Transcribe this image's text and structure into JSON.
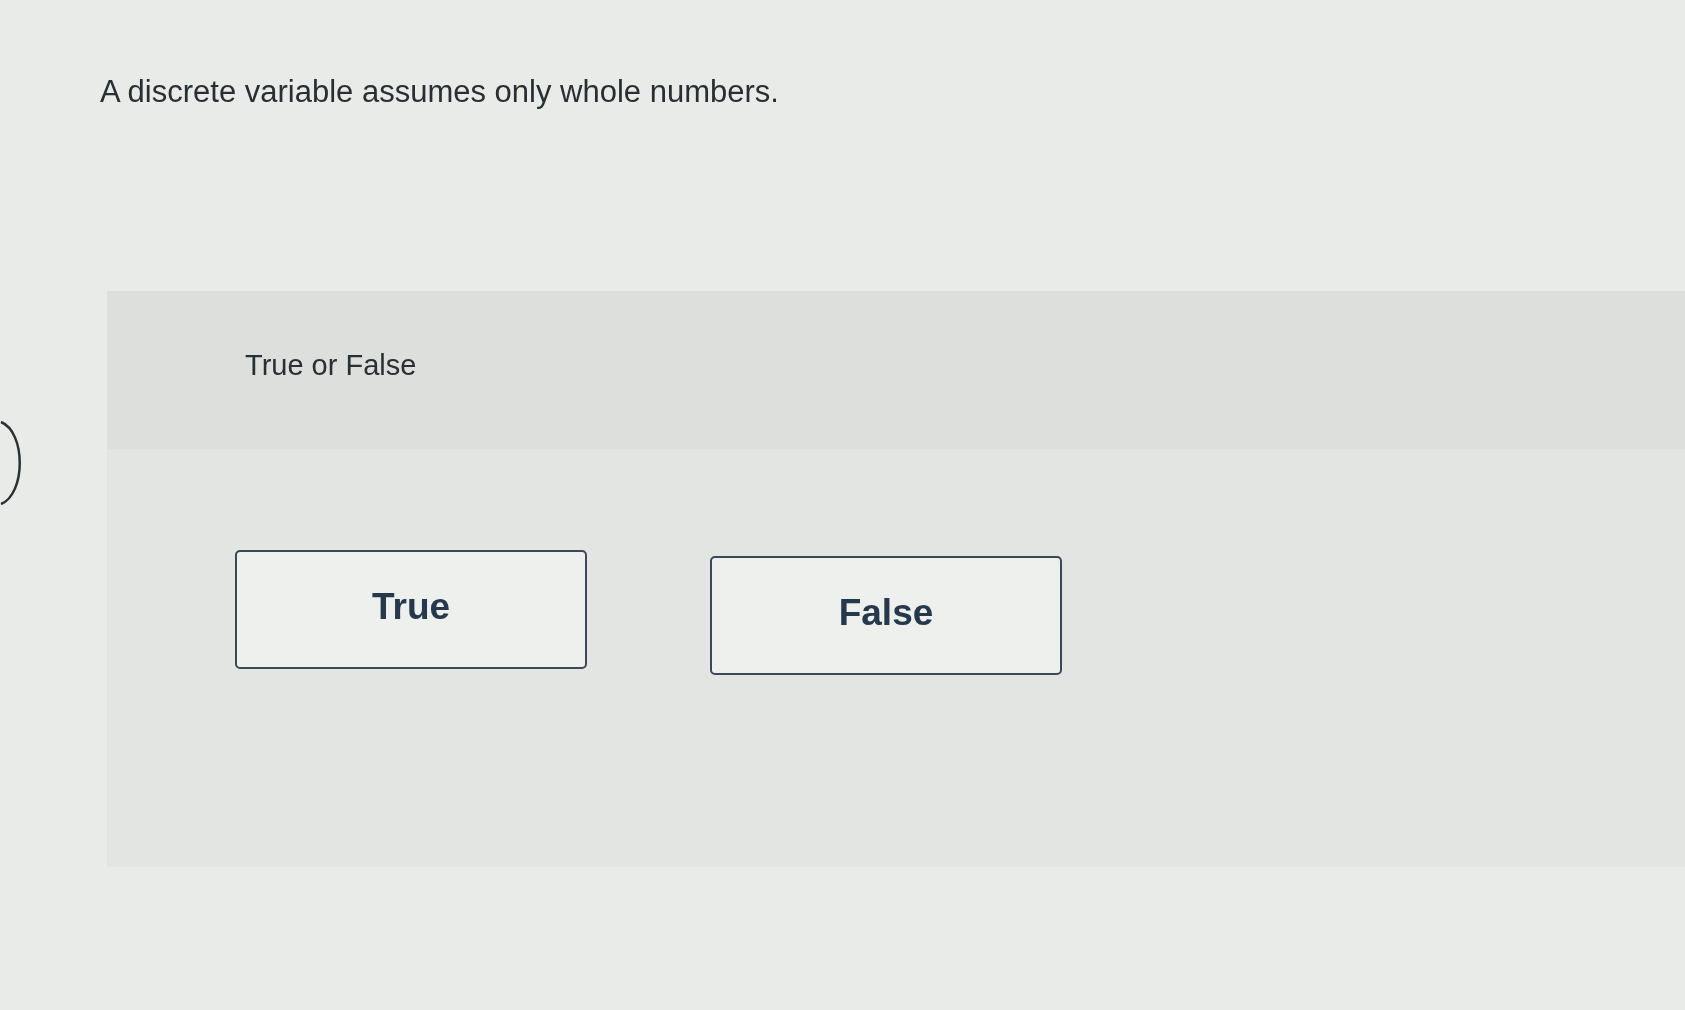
{
  "question": {
    "text": "A discrete variable assumes only whole numbers."
  },
  "answer_panel": {
    "prompt": "True or False",
    "options": [
      {
        "label": "True",
        "selected": false
      },
      {
        "label": "False",
        "selected": false
      }
    ]
  }
}
